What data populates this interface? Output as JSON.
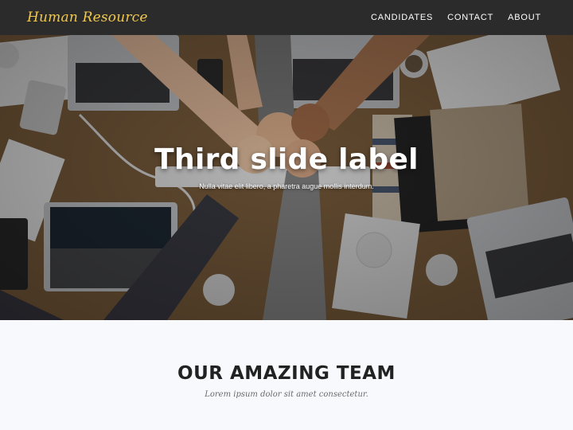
{
  "navbar": {
    "brand": "Human Resource",
    "links": [
      {
        "label": "CANDIDATES"
      },
      {
        "label": "CONTACT"
      },
      {
        "label": "ABOUT"
      }
    ]
  },
  "hero": {
    "slide_title": "Third slide label",
    "slide_text": "Nulla vitae elit libero, a pharetra augue mollis interdum."
  },
  "team": {
    "title": "OUR AMAZING TEAM",
    "subtitle": "Lorem ipsum dolor sit amet consectetur."
  },
  "colors": {
    "navbar_bg": "#2b2b2b",
    "brand": "#f2c94c",
    "section_bg": "#f7f9fc"
  }
}
